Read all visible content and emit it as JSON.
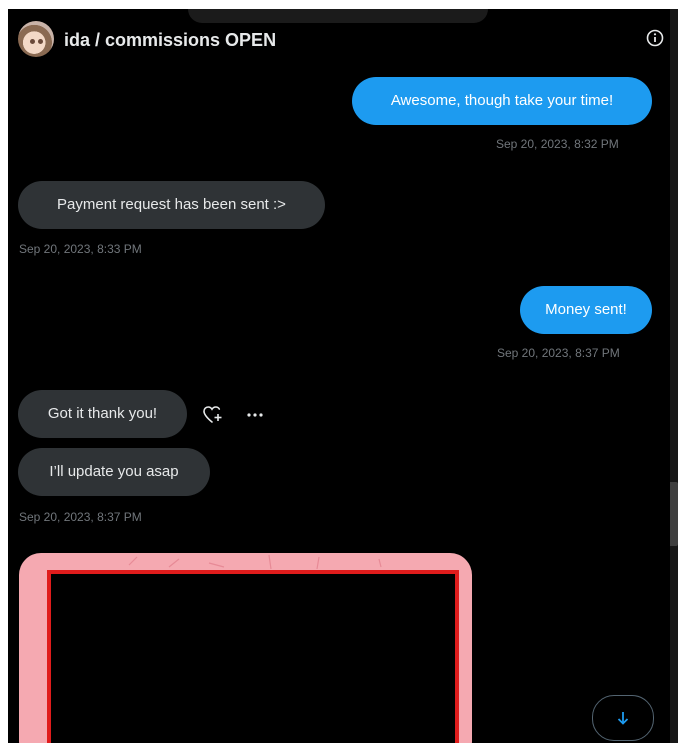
{
  "header": {
    "title": "ida / commissions OPEN",
    "avatar_icon": "profile-avatar",
    "info_icon": "info-circle-icon"
  },
  "messages": [
    {
      "direction": "outgoing",
      "text": "Awesome, though take your time!",
      "timestamp": "Sep 20, 2023, 8:32 PM"
    },
    {
      "direction": "incoming",
      "text": "Payment request has been sent :>",
      "timestamp": "Sep 20, 2023, 8:33 PM"
    },
    {
      "direction": "outgoing",
      "text": "Money sent!",
      "timestamp": "Sep 20, 2023, 8:37 PM"
    },
    {
      "direction": "incoming",
      "text": "Got it thank you!"
    },
    {
      "direction": "incoming",
      "text": "I’ll update you asap",
      "timestamp": "Sep 20, 2023, 8:37 PM"
    }
  ],
  "message_actions": {
    "react_icon": "heart-plus-icon",
    "more_icon": "more-horizontal-icon"
  },
  "attachment": {
    "type": "image",
    "frame_color": "#f5a9b1",
    "border_color": "#e01c1c"
  },
  "scroll_down_icon": "arrow-down-icon",
  "colors": {
    "background": "#000000",
    "outgoing_bubble": "#1d9bf0",
    "incoming_bubble": "#2f3336",
    "timestamp": "#71767b",
    "text": "#e7e9ea"
  }
}
